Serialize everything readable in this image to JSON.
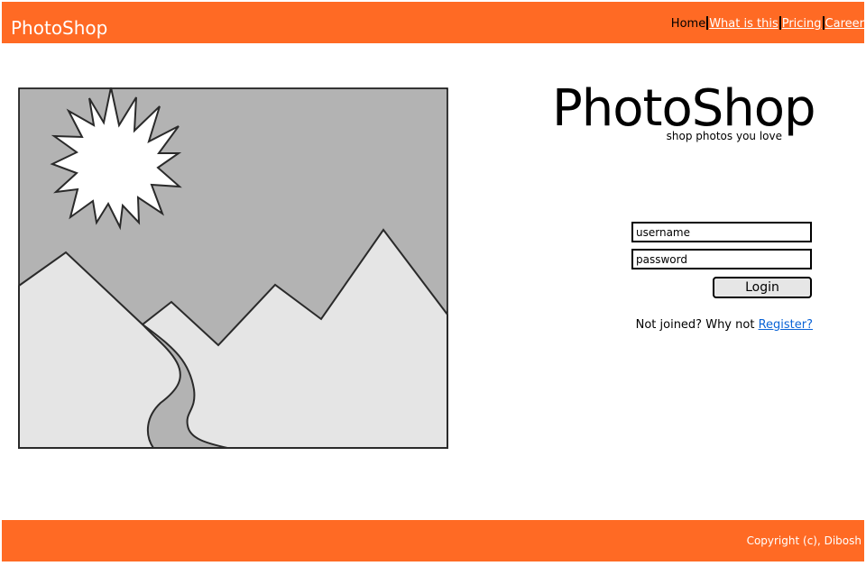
{
  "colors": {
    "brand_orange": "#ff6a24",
    "sky": "#b3b3b3",
    "mountain": "#e5e5e5",
    "river": "#b3b3b3",
    "link_blue": "#0a63d6"
  },
  "header": {
    "brand": "PhotoShop",
    "nav": [
      {
        "label": "Home",
        "current": true
      },
      {
        "label": "What is this",
        "current": false
      },
      {
        "label": "Pricing",
        "current": false
      },
      {
        "label": "Career",
        "current": false
      }
    ]
  },
  "hero": {
    "image_icon": "image-placeholder-icon"
  },
  "logo": {
    "title": "PhotoShop",
    "tagline": "shop photos you love"
  },
  "login": {
    "username_value": "username",
    "password_value": "password",
    "button_label": "Login",
    "register_prompt": "Not joined? Why not ",
    "register_link": "Register?"
  },
  "footer": {
    "copyright": "Copyright (c), Dibosh"
  }
}
